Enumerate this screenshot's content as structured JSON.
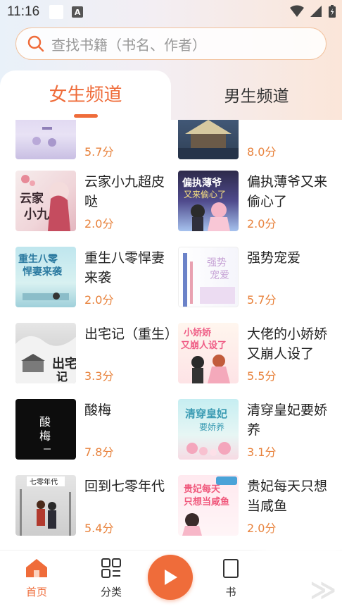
{
  "status_bar": {
    "time": "11:16",
    "a_icon": "A"
  },
  "search": {
    "placeholder": "查找书籍（书名、作者）"
  },
  "tabs": [
    {
      "label": "女生频道",
      "active": true
    },
    {
      "label": "男生频道",
      "active": false
    }
  ],
  "books": [
    {
      "title": "",
      "score": "5.7分",
      "cover": "top-partial-left"
    },
    {
      "title": "",
      "score": "8.0分",
      "cover": "top-partial-right"
    },
    {
      "title": "云家小九超皮哒",
      "score": "2.0分",
      "cover_text": "云家小九"
    },
    {
      "title": "偏执薄爷又来偷心了",
      "score": "2.0分",
      "cover_text": "偏执薄爷"
    },
    {
      "title": "重生八零悍妻来袭",
      "score": "2.0分",
      "cover_text": "重生八零 悍妻来袭"
    },
    {
      "title": "强势宠爱",
      "score": "5.7分",
      "cover_text": "强势 宠爱"
    },
    {
      "title": "出宅记（重生）",
      "score": "3.3分",
      "cover_text": "出宅记"
    },
    {
      "title": "大佬的小娇娇又崩人设了",
      "score": "5.5分",
      "cover_text": "小娇娇 又崩人设了"
    },
    {
      "title": "酸梅",
      "score": "7.8分",
      "cover_text": "酸梅"
    },
    {
      "title": "清穿皇妃要娇养",
      "score": "3.1分",
      "cover_text": "清穿皇妃 要娇养"
    },
    {
      "title": "回到七零年代",
      "score": "5.4分",
      "cover_text": "七零年代"
    },
    {
      "title": "贵妃每天只想当咸鱼",
      "score": "2.0分",
      "cover_text": "贵妃每天只想当咸鱼"
    }
  ],
  "nav": {
    "home": "首页",
    "category": "分类",
    "shelf": "书"
  },
  "colors": {
    "accent": "#ef6c3a",
    "score": "#e8823c"
  },
  "icons": [
    "search-icon",
    "home-icon",
    "category-icon",
    "play-icon",
    "shelf-icon",
    "wifi-icon",
    "signal-icon",
    "battery-icon"
  ]
}
